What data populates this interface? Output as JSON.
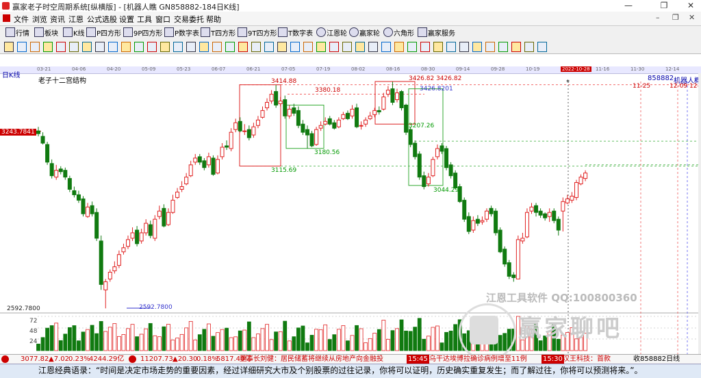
{
  "window": {
    "title": "赢家老子时空周期系统[纵横版] - [机器人瞧  GN858882-184日K线]",
    "controls": [
      "—",
      "❐",
      "✕"
    ]
  },
  "menu": [
    "文件",
    "浏览",
    "资讯",
    "江恩",
    "公式选股",
    "设置",
    "工具",
    "窗口",
    "交易委托",
    "帮助"
  ],
  "mdi_controls": [
    "–",
    "❐",
    "✕"
  ],
  "toolbar": [
    "行情",
    "板块",
    "K线",
    "P四方形",
    "9P四方形",
    "P数字表",
    "T四方形",
    "9T四方形",
    "T数字表",
    "江恩轮",
    "赢家轮",
    "六角形",
    "赢家服务"
  ],
  "date_axis": [
    "03-21",
    "04-06",
    "04-20",
    "05-09",
    "05-23",
    "06-07",
    "06-21",
    "07-05",
    "07-19",
    "08-02",
    "08-16",
    "08-30",
    "09-14",
    "09-28",
    "10-19",
    "2022-10-28",
    "11-16",
    "11-30",
    "12-14"
  ],
  "chart": {
    "period_label": "日K线",
    "indicator_name": "老子十二宫结构",
    "code_label": "858882",
    "name_label": "机器人概",
    "price_tag": "3243.7841",
    "low_tag": "2592.7800",
    "low_label": "2592.7800",
    "right_date1": "11-25",
    "right_date2": "12-09 12-1",
    "labels": [
      "3414.88",
      "3380.18",
      "3426.82 3426.82",
      "3426.8201",
      "3115.69",
      "3180.56",
      "3044.29",
      "3207.26"
    ],
    "vol_ticks": [
      "72",
      "48",
      "24"
    ],
    "bull_color": "#e02020",
    "bear_color": "#107a10",
    "series": {
      "open": [
        3245,
        3225,
        3195,
        3125,
        3075,
        3105,
        3100,
        3070,
        3025,
        3010,
        2995,
        2930,
        2970,
        2945,
        2840,
        2660,
        2700,
        2730,
        2750,
        2800,
        2820,
        2850,
        2880,
        2840,
        2870,
        2900,
        2850,
        2930,
        2960,
        2900,
        2945,
        3000,
        3030,
        3050,
        3080,
        3130,
        3150,
        3135,
        3120,
        3145,
        3090,
        3150,
        3190,
        3180,
        3250,
        3280,
        3245,
        3250,
        3230,
        3265,
        3295,
        3330,
        3355,
        3390,
        3345,
        3360,
        3300,
        3330,
        3320,
        3270,
        3250,
        3235,
        3195,
        3255,
        3270,
        3290,
        3275,
        3260,
        3290,
        3310,
        3300,
        3330,
        3265,
        3270,
        3290,
        3305,
        3320,
        3325,
        3380,
        3400,
        3360,
        3390,
        3340,
        3250,
        3200,
        3160,
        3080,
        3050,
        3080,
        3150,
        3190,
        3180,
        3120,
        3090,
        3040,
        2990,
        2930,
        2880,
        2920,
        2910,
        2920,
        2960,
        2950,
        2880,
        2810,
        2760,
        2715,
        2700,
        2840,
        2855,
        2950,
        2970,
        2950,
        2940,
        2930,
        2950,
        2920,
        2950,
        2980,
        2990,
        3000,
        3050,
        3070
      ],
      "close": [
        3235,
        3200,
        3130,
        3080,
        3100,
        3095,
        3075,
        3030,
        3010,
        2990,
        2940,
        2965,
        2940,
        2850,
        2680,
        2690,
        2725,
        2745,
        2790,
        2815,
        2845,
        2870,
        2830,
        2870,
        2905,
        2860,
        2920,
        2950,
        2895,
        2945,
        2990,
        3020,
        3040,
        3075,
        3120,
        3145,
        3130,
        3110,
        3150,
        3085,
        3140,
        3185,
        3185,
        3240,
        3275,
        3245,
        3245,
        3220,
        3260,
        3285,
        3320,
        3350,
        3380,
        3340,
        3355,
        3300,
        3325,
        3310,
        3265,
        3240,
        3230,
        3190,
        3250,
        3265,
        3280,
        3270,
        3255,
        3285,
        3305,
        3290,
        3325,
        3260,
        3265,
        3285,
        3300,
        3320,
        3315,
        3370,
        3395,
        3350,
        3385,
        3330,
        3240,
        3195,
        3150,
        3075,
        3040,
        3075,
        3140,
        3180,
        3170,
        3110,
        3080,
        3035,
        2985,
        2920,
        2875,
        2915,
        2905,
        2915,
        2950,
        2940,
        2870,
        2800,
        2755,
        2710,
        2705,
        2845,
        2850,
        2945,
        2965,
        2945,
        2935,
        2925,
        2945,
        2915,
        2880,
        2985,
        2995,
        3005,
        3055,
        3075,
        3090
      ],
      "high": [
        3260,
        3240,
        3205,
        3140,
        3120,
        3115,
        3110,
        3080,
        3040,
        3025,
        3005,
        2980,
        2985,
        2960,
        2860,
        2700,
        2735,
        2765,
        2805,
        2830,
        2860,
        2890,
        2895,
        2885,
        2920,
        2915,
        2935,
        2970,
        2975,
        2960,
        3010,
        3035,
        3060,
        3090,
        3135,
        3160,
        3160,
        3145,
        3165,
        3155,
        3155,
        3200,
        3210,
        3255,
        3290,
        3295,
        3270,
        3265,
        3275,
        3300,
        3335,
        3365,
        3395,
        3414,
        3370,
        3375,
        3340,
        3345,
        3335,
        3285,
        3265,
        3245,
        3260,
        3280,
        3295,
        3300,
        3285,
        3295,
        3315,
        3320,
        3340,
        3345,
        3280,
        3295,
        3315,
        3330,
        3335,
        3385,
        3410,
        3426,
        3400,
        3395,
        3345,
        3260,
        3210,
        3170,
        3095,
        3090,
        3150,
        3195,
        3200,
        3190,
        3130,
        3100,
        3050,
        3000,
        2945,
        2930,
        2935,
        2930,
        2960,
        2970,
        2960,
        2890,
        2820,
        2770,
        2725,
        2860,
        2870,
        2960,
        2980,
        2980,
        2960,
        2945,
        2960,
        2960,
        2930,
        3000,
        3010,
        3020,
        3065,
        3085,
        3100
      ],
      "low": [
        3225,
        3195,
        3120,
        3070,
        3065,
        3085,
        3065,
        3020,
        3000,
        2980,
        2930,
        2925,
        2930,
        2840,
        2660,
        2592,
        2690,
        2720,
        2740,
        2790,
        2810,
        2840,
        2820,
        2830,
        2860,
        2850,
        2840,
        2920,
        2890,
        2895,
        2940,
        2995,
        3020,
        3045,
        3075,
        3120,
        3120,
        3100,
        3110,
        3080,
        3085,
        3140,
        3175,
        3170,
        3240,
        3240,
        3230,
        3210,
        3220,
        3255,
        3290,
        3320,
        3345,
        3330,
        3335,
        3290,
        3290,
        3300,
        3255,
        3230,
        3180,
        3185,
        3190,
        3245,
        3265,
        3265,
        3250,
        3255,
        3285,
        3285,
        3290,
        3255,
        3250,
        3260,
        3285,
        3295,
        3305,
        3320,
        3370,
        3340,
        3350,
        3320,
        3230,
        3185,
        3140,
        3065,
        3030,
        3040,
        3075,
        3140,
        3160,
        3100,
        3070,
        3030,
        2980,
        2910,
        2865,
        2870,
        2895,
        2900,
        2910,
        2930,
        2860,
        2795,
        2745,
        2700,
        2690,
        2700,
        2830,
        2850,
        2940,
        2930,
        2925,
        2915,
        2910,
        2905,
        2860,
        2875,
        2975,
        2980,
        2990,
        3045,
        3060
      ]
    }
  },
  "watermark": {
    "line1": "江恩工具软件  QQ:100800360",
    "line2": "赢家聊吧"
  },
  "status": {
    "sh_index": "3077.82",
    "sh_change": "▲7.02",
    "sh_pct": "0.23%",
    "sh_amount": "4244.29亿",
    "sz_index": "11207.73",
    "sz_change": "▲20.30",
    "sz_pct": "0.18%",
    "sz_amount": "5817.40亿",
    "news1": "董事长刘健：居民储蓄将继续从房地产向金融投",
    "time1": "15:45",
    "news2": "乌干达埃博拉确诊病例增至11例",
    "time2": "15:30",
    "news3": "汉王科技：首款",
    "tail": "收858882日线"
  },
  "quote": "江恩经典语录：“时间是决定市场走势的重要因素，经过详细研究大市及个别股票的过往记录，你将可以证明，历史确实重复发生；而了解过往，你将可以预测将来。”。"
}
